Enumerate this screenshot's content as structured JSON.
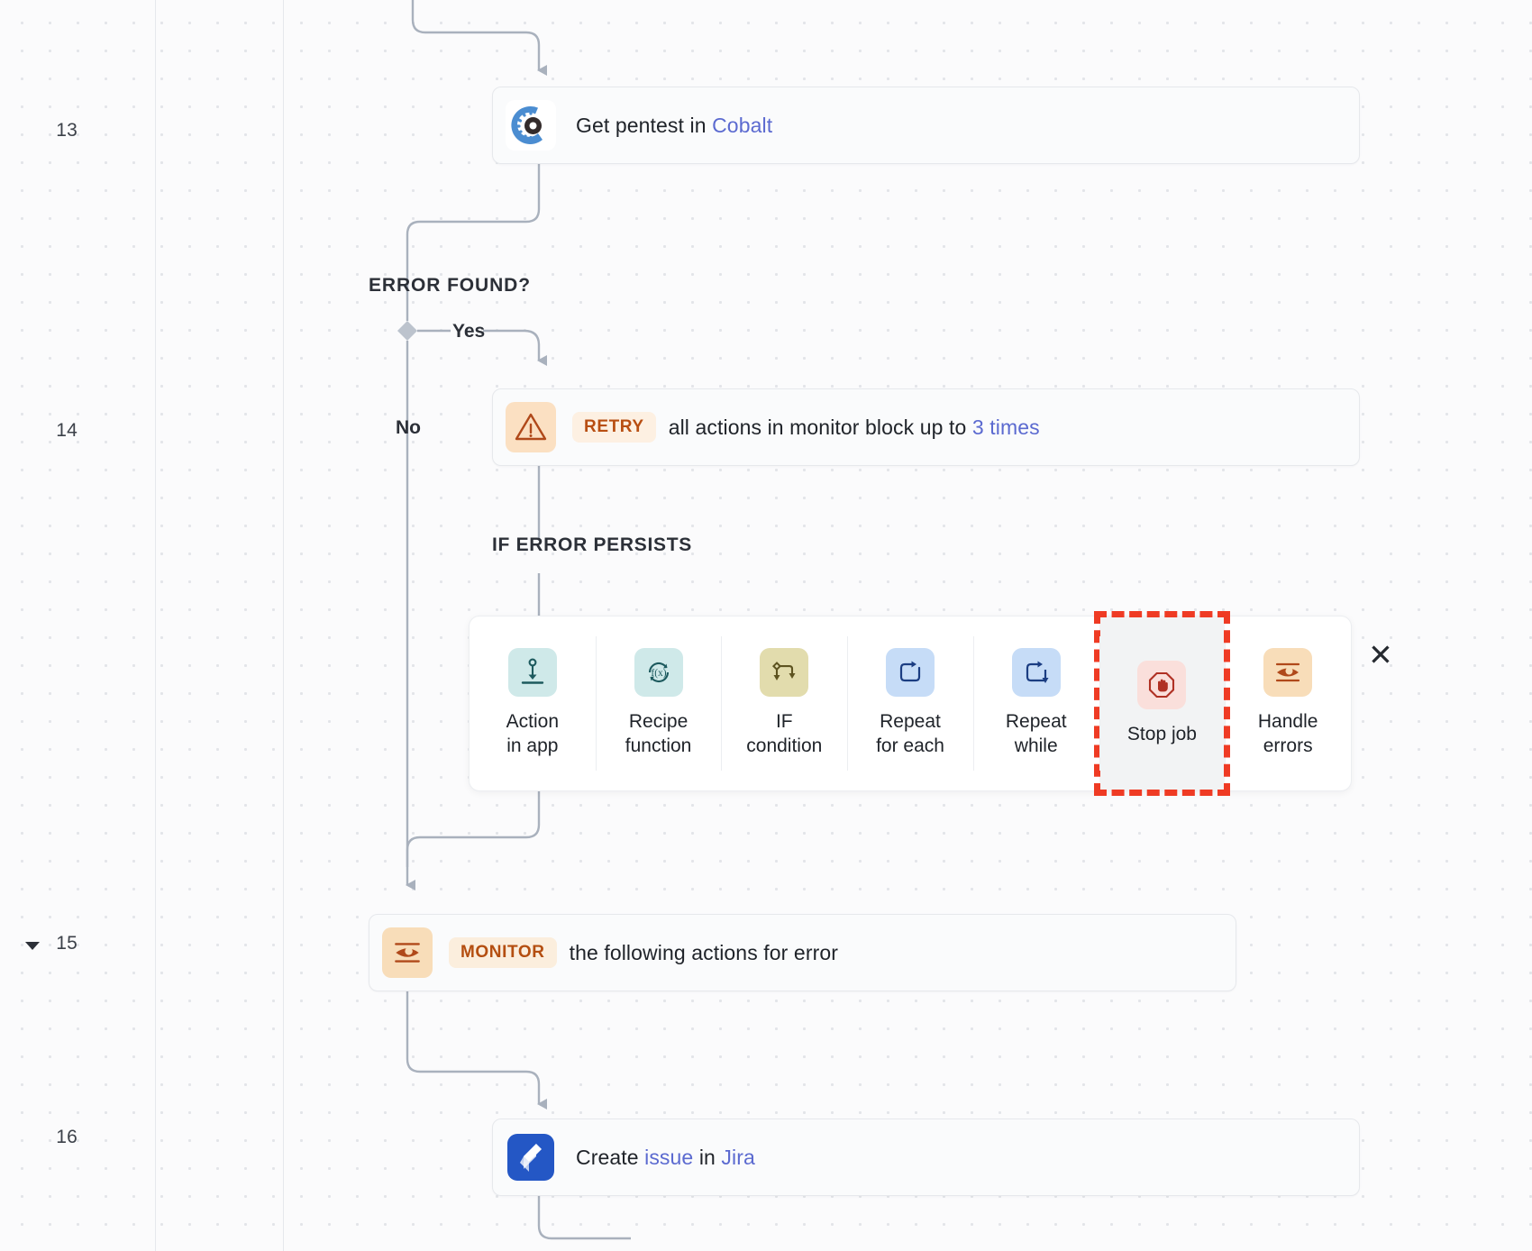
{
  "workflow": {
    "steps": [
      {
        "number": "13",
        "icon": "cobalt-icon",
        "text_before": "Get pentest in ",
        "link": "Cobalt",
        "text_after": ""
      },
      {
        "number": "14",
        "icon": "warning-triangle-icon",
        "pill": "RETRY",
        "text_before": "all actions in monitor block up to ",
        "link": "3 times",
        "text_after": ""
      },
      {
        "number": "15",
        "icon": "eye-monitor-icon",
        "pill": "MONITOR",
        "text_before": "the following actions for error",
        "link": "",
        "text_after": "",
        "collapsible": true
      },
      {
        "number": "16",
        "icon": "jira-icon",
        "text_before": "Create ",
        "link": "issue",
        "text_after": " in ",
        "link2": "Jira"
      }
    ],
    "branch": {
      "condition_label": "ERROR FOUND?",
      "yes_label": "Yes",
      "no_label": "No",
      "persist_label": "IF ERROR PERSISTS"
    }
  },
  "palette": {
    "close_label": "✕",
    "items": [
      {
        "icon": "action-in-app-icon",
        "line1": "Action",
        "line2": "in app",
        "swatch": "teal"
      },
      {
        "icon": "recipe-function-icon",
        "line1": "Recipe",
        "line2": "function",
        "swatch": "teal"
      },
      {
        "icon": "if-condition-icon",
        "line1": "IF",
        "line2": "condition",
        "swatch": "olive"
      },
      {
        "icon": "repeat-for-each-icon",
        "line1": "Repeat",
        "line2": "for each",
        "swatch": "blue"
      },
      {
        "icon": "repeat-while-icon",
        "line1": "Repeat",
        "line2": "while",
        "swatch": "blue"
      },
      {
        "icon": "stop-job-icon",
        "line1": "Stop job",
        "line2": "",
        "swatch": "rose",
        "highlighted": true
      },
      {
        "icon": "handle-errors-icon",
        "line1": "Handle",
        "line2": "errors",
        "swatch": "peach"
      }
    ]
  },
  "colors": {
    "accent_link": "#5b6ad0",
    "retry_pill_bg": "#fdf0e2",
    "retry_pill_fg": "#b84e12",
    "monitor_pill_bg": "#fbeedd",
    "monitor_pill_fg": "#b44e10",
    "highlight_outline": "#ef3b24",
    "canvas_bg": "#fbfbfc",
    "card_border": "#e6e8ec",
    "wire": "#a9b1bd"
  }
}
